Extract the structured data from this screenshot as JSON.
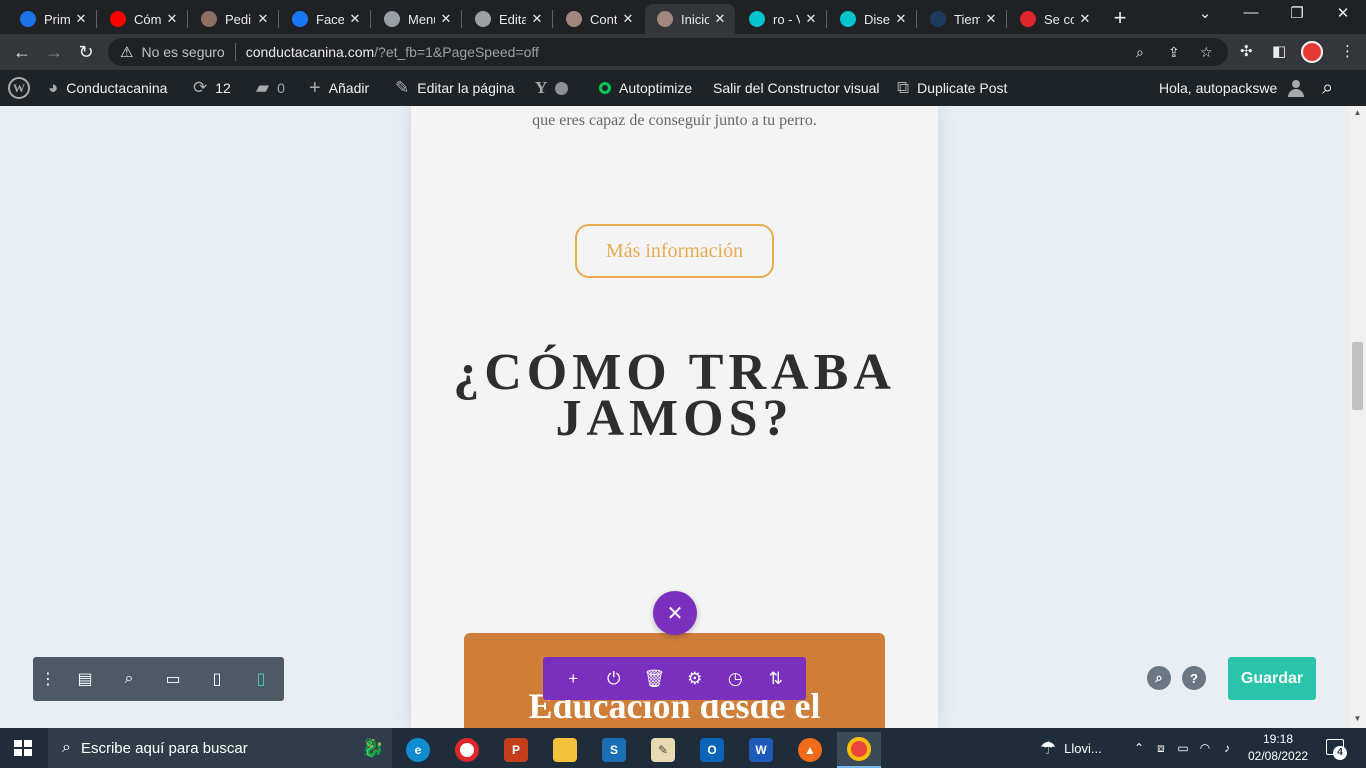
{
  "browser": {
    "tabs": [
      {
        "title": "Prim",
        "icon": "play-icon",
        "color": "#1a73e8"
      },
      {
        "title": "Cóm",
        "icon": "youtube-icon",
        "color": "#ff0000"
      },
      {
        "title": "Pedi",
        "icon": "image-icon",
        "color": "#8d6e63"
      },
      {
        "title": "Facel",
        "icon": "facebook-icon",
        "color": "#1877f2"
      },
      {
        "title": "Menu",
        "icon": "globe-icon",
        "color": "#9aa0a6"
      },
      {
        "title": "Edita",
        "icon": "globe-icon",
        "color": "#9aa0a6"
      },
      {
        "title": "Conti",
        "icon": "dog-icon",
        "color": "#a1887f"
      },
      {
        "title": "Inicio",
        "icon": "dog-icon",
        "color": "#a1887f",
        "active": true
      },
      {
        "title": "ro - V",
        "icon": "canva-icon",
        "color": "#00c4cc"
      },
      {
        "title": "Disei",
        "icon": "canva-icon",
        "color": "#00c4cc"
      },
      {
        "title": "Tiem",
        "icon": "mb-icon",
        "color": "#1e3a5f"
      },
      {
        "title": "Se co",
        "icon": "w-icon",
        "color": "#e0262d"
      }
    ],
    "not_secure_label": "No es seguro",
    "url_host": "conductacanina.com",
    "url_path": "/?et_fb=1&PageSpeed=off"
  },
  "wp_admin_bar": {
    "site_name": "Conductacanina",
    "updates_count": "12",
    "comments_count": "0",
    "add_new_label": "Añadir",
    "edit_page_label": "Editar la página",
    "autoptimize_label": "Autoptimize",
    "exit_builder_label": "Salir del Constructor visual",
    "duplicate_post_label": "Duplicate Post",
    "greeting": "Hola, autopackswe"
  },
  "page": {
    "intro_text": "que eres capaz de conseguir junto a tu perro.",
    "more_info_button": "Más información",
    "section_heading": "¿CÓMO TRABAJAMOS?",
    "orange_section_title": "Educación desde el",
    "accent_color": "#e8ab52",
    "orange_bg": "#cf7e3a",
    "builder_purple": "#7b2fbf"
  },
  "builder": {
    "save_label": "Guardar",
    "active_view": "phone"
  },
  "taskbar": {
    "search_placeholder": "Escribe aquí para buscar",
    "weather": "Llovi...",
    "time": "19:18",
    "date": "02/08/2022",
    "notifications": "4"
  }
}
